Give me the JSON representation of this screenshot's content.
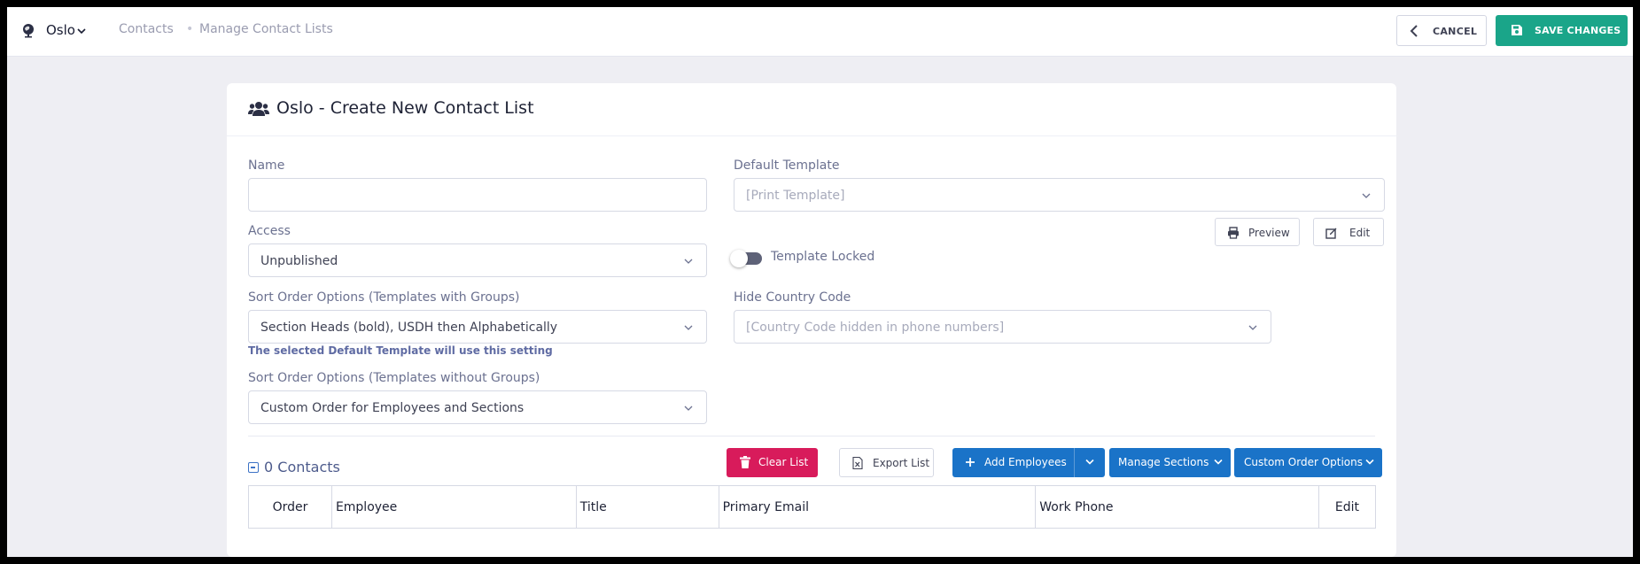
{
  "topbar": {
    "org_name": "Oslo",
    "org_icon": "globe-pin-icon",
    "breadcrumb": [
      "Contacts",
      "Manage Contact Lists"
    ],
    "breadcrumb_separator": "•",
    "cancel_label": "CANCEL",
    "save_label": "SAVE CHANGES",
    "save_color": "#1aa589"
  },
  "card": {
    "title": "Oslo - Create New Contact List",
    "title_icon": "users-icon"
  },
  "form": {
    "name": {
      "label": "Name",
      "value": ""
    },
    "default_template": {
      "label": "Default Template",
      "placeholder": "[Print Template]"
    },
    "preview_label": "Preview",
    "edit_label": "Edit",
    "access": {
      "label": "Access",
      "value": "Unpublished"
    },
    "template_locked": {
      "label": "Template Locked",
      "on": false
    },
    "sort_groups": {
      "label": "Sort Order Options (Templates with Groups)",
      "value": "Section Heads (bold), USDH then Alphabetically"
    },
    "sort_groups_hint": "The selected Default Template will use this setting",
    "hide_country_code": {
      "label": "Hide Country Code",
      "placeholder": "[Country Code hidden in phone numbers]"
    },
    "sort_no_groups": {
      "label": "Sort Order Options (Templates without Groups)",
      "value": "Custom Order for Employees and Sections"
    }
  },
  "contacts": {
    "count_label": "0 Contacts",
    "clear_label": "Clear List",
    "export_label": "Export List",
    "add_employees_label": "Add Employees",
    "manage_sections_label": "Manage Sections",
    "custom_order_label": "Custom Order Options",
    "clear_color": "#d81b5b",
    "action_color": "#1a73c8",
    "columns": [
      "Order",
      "Employee",
      "Title",
      "Primary Email",
      "Work Phone",
      "Edit"
    ]
  }
}
